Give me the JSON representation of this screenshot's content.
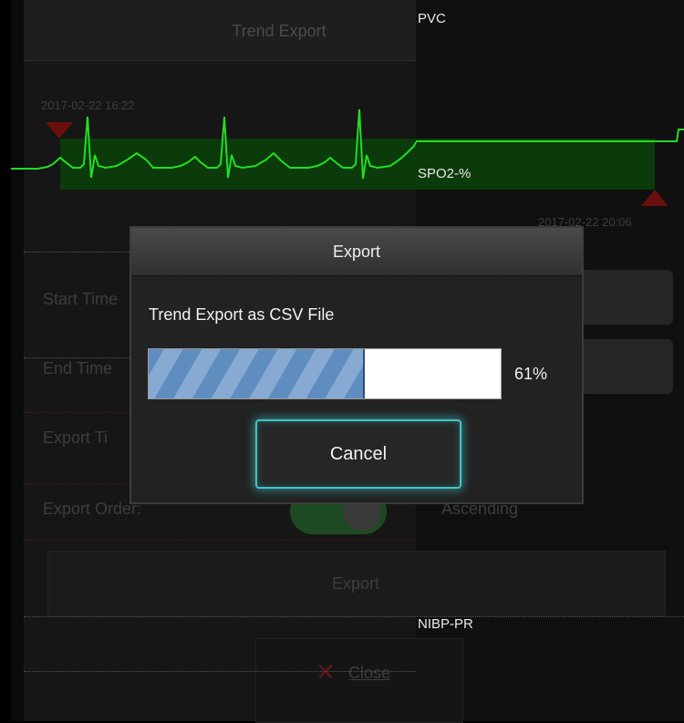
{
  "background_dialog": {
    "title": "Trend Export",
    "start_time_value": "2017-02-22 16:22",
    "end_time_value": "2017-02-22 20:06",
    "rows": {
      "start_time": "Start Time",
      "end_time": "End Time",
      "export_time": "Export Ti",
      "export_order": "Export Order:"
    },
    "export_order_value": "Ascending",
    "export_button": "Export",
    "close_button": "Close"
  },
  "parameters": {
    "pvc": "PVC",
    "spo2": "SPO2-%",
    "nibp_pr": "NIBP-PR"
  },
  "export_modal": {
    "title": "Export",
    "message": "Trend Export as CSV File",
    "progress_percent": 61,
    "progress_label": "61%",
    "cancel_label": "Cancel"
  },
  "colors": {
    "waveform": "#22dd22",
    "accent_glow": "#40c4c8",
    "progress_fill": "#6f97c6"
  }
}
